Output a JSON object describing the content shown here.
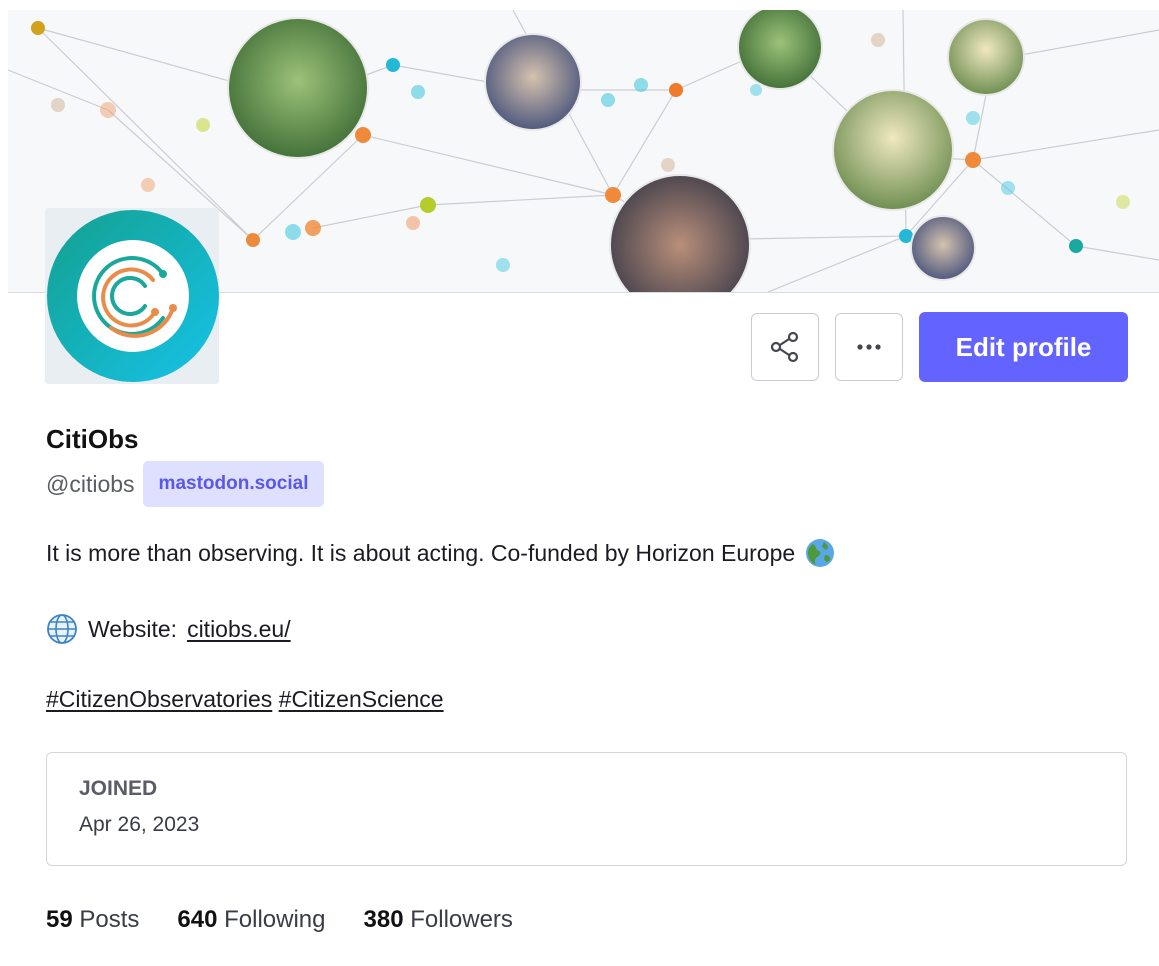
{
  "profile": {
    "display_name": "CitiObs",
    "handle": "@citiobs",
    "domain": "mastodon.social",
    "bio": "It is more than observing. It is about acting. Co-funded by Horizon Europe",
    "website_label": "Website:",
    "website_link": "citiobs.eu/",
    "hashtags": [
      "#CitizenObservatories",
      "#CitizenScience"
    ]
  },
  "actions": {
    "share_icon": "share-icon",
    "more_icon": "more-icon",
    "edit_label": "Edit profile"
  },
  "joined": {
    "label": "JOINED",
    "date": "Apr 26, 2023"
  },
  "stats": {
    "posts_count": "59",
    "posts_label": "Posts",
    "following_count": "640",
    "following_label": "Following",
    "followers_count": "380",
    "followers_label": "Followers"
  },
  "colors": {
    "accent": "#6364ff",
    "badge_bg": "#dfe0ff",
    "badge_text": "#5a58e8",
    "logo_teal": "#13a59a",
    "logo_blue": "#16bfe0"
  }
}
